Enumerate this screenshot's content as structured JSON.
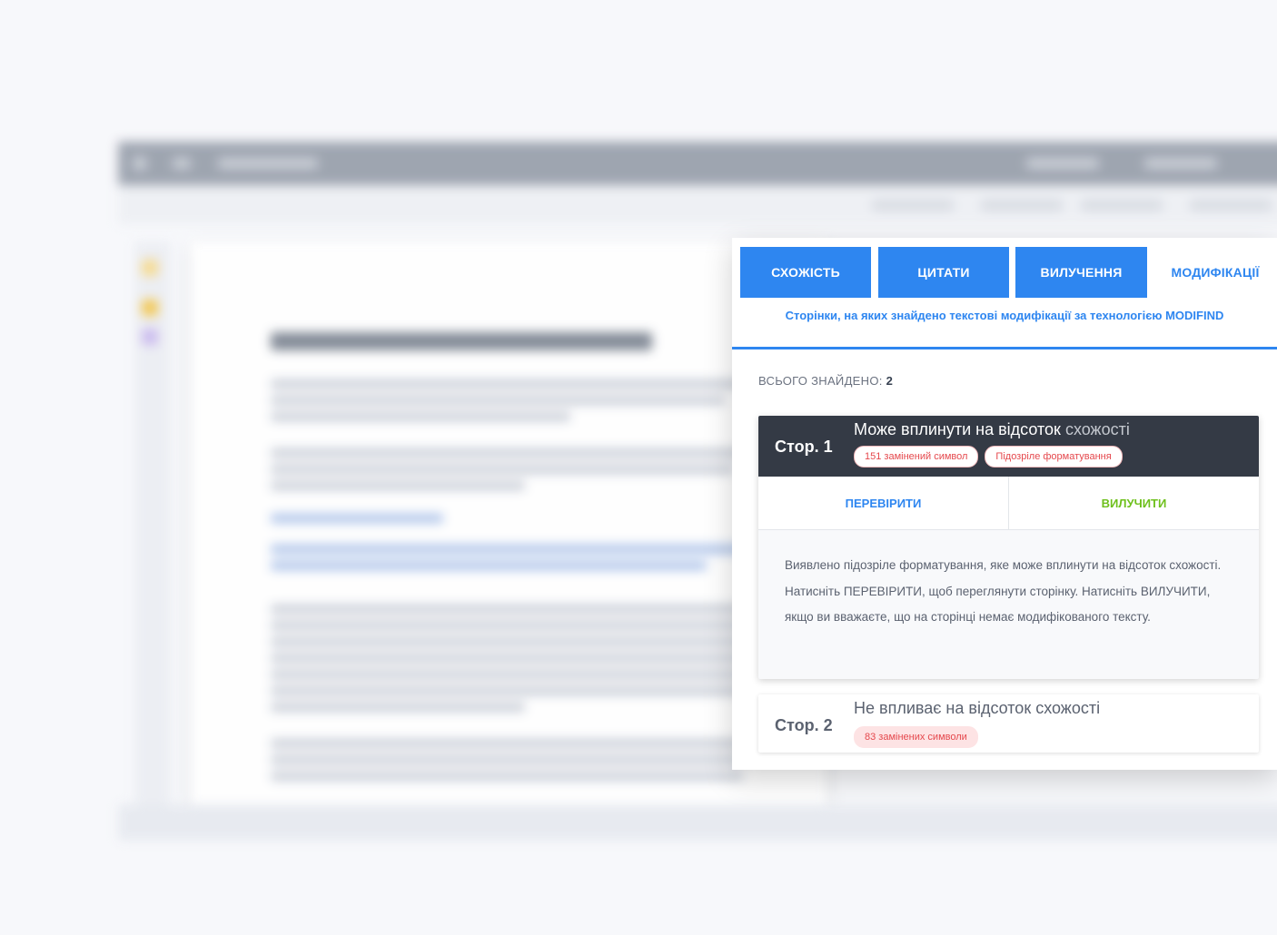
{
  "tabs": [
    {
      "label": "СХОЖІСТЬ"
    },
    {
      "label": "ЦИТАТИ"
    },
    {
      "label": "ВИЛУЧЕННЯ"
    },
    {
      "label": "МОДИФІКАЦІЇ"
    }
  ],
  "subtitle": "Сторінки, на яких знайдено текстові модифікації за технологією MODIFIND",
  "total": {
    "label": "ВСЬОГО ЗНАЙДЕНО:",
    "value": "2"
  },
  "results": [
    {
      "page": "Стор. 1",
      "desc_main": "Може вплинути на відсоток",
      "desc_tail": "схожості",
      "badges": [
        "151 замінений символ",
        "Підозріле форматування"
      ],
      "actions": {
        "check": "ПЕРЕВІРИТИ",
        "remove": "ВИЛУЧИТИ"
      },
      "info": "Виявлено підозріле форматування, яке може вплинути на відсоток схожості. Натисніть ПЕРЕВІРИТИ, щоб переглянути сторінку. Натисніть ВИЛУЧИТИ, якщо ви вважаєте, що на сторінці немає модифікованого тексту."
    },
    {
      "page": "Стор. 2",
      "desc": "Не впливає на відсоток схожості",
      "badges": [
        "83 замінених символи"
      ]
    }
  ],
  "colors": {
    "accent": "#2e86f0",
    "dark": "#343a45",
    "danger": "#e5484d",
    "success": "#6ec01c"
  }
}
